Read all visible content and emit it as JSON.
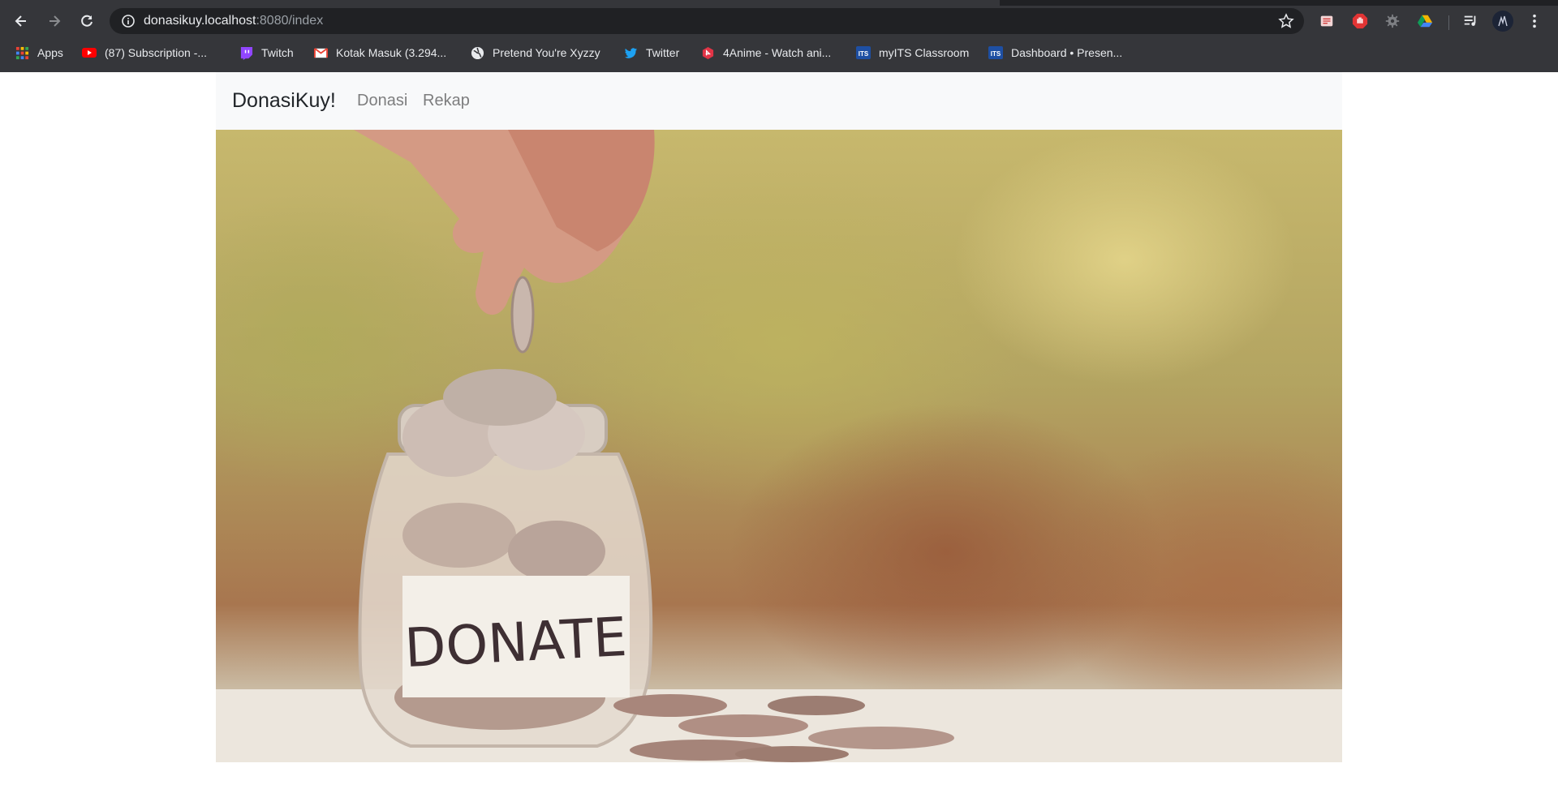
{
  "browser": {
    "url_host": "donasikuy.localhost",
    "url_rest": ":8080/index",
    "bookmarks": [
      {
        "label": "Apps",
        "icon": "apps-grid-icon"
      },
      {
        "label": "(87) Subscription -...",
        "icon": "youtube-icon"
      },
      {
        "label": "Twitch",
        "icon": "twitch-icon"
      },
      {
        "label": "Kotak Masuk (3.294...",
        "icon": "gmail-icon"
      },
      {
        "label": "Pretend You're Xyzzy",
        "icon": "globe-icon"
      },
      {
        "label": "Twitter",
        "icon": "twitter-icon"
      },
      {
        "label": "4Anime - Watch ani...",
        "icon": "4anime-icon"
      },
      {
        "label": "myITS Classroom",
        "icon": "its-icon"
      },
      {
        "label": "Dashboard • Presen...",
        "icon": "its-icon"
      }
    ],
    "extensions": [
      "pdf-extension-icon",
      "adblock-extension-icon",
      "gear-extension-icon",
      "drive-extension-icon",
      "playlist-icon",
      "profile-avatar"
    ]
  },
  "site": {
    "brand": "DonasiKuy!",
    "nav": [
      "Donasi",
      "Rekap"
    ],
    "hero": {
      "label_text": "DONATE",
      "colors": {
        "background_top": "#c7b86d",
        "background_mid": "#a8764f",
        "table": "#e9e3da"
      }
    }
  }
}
